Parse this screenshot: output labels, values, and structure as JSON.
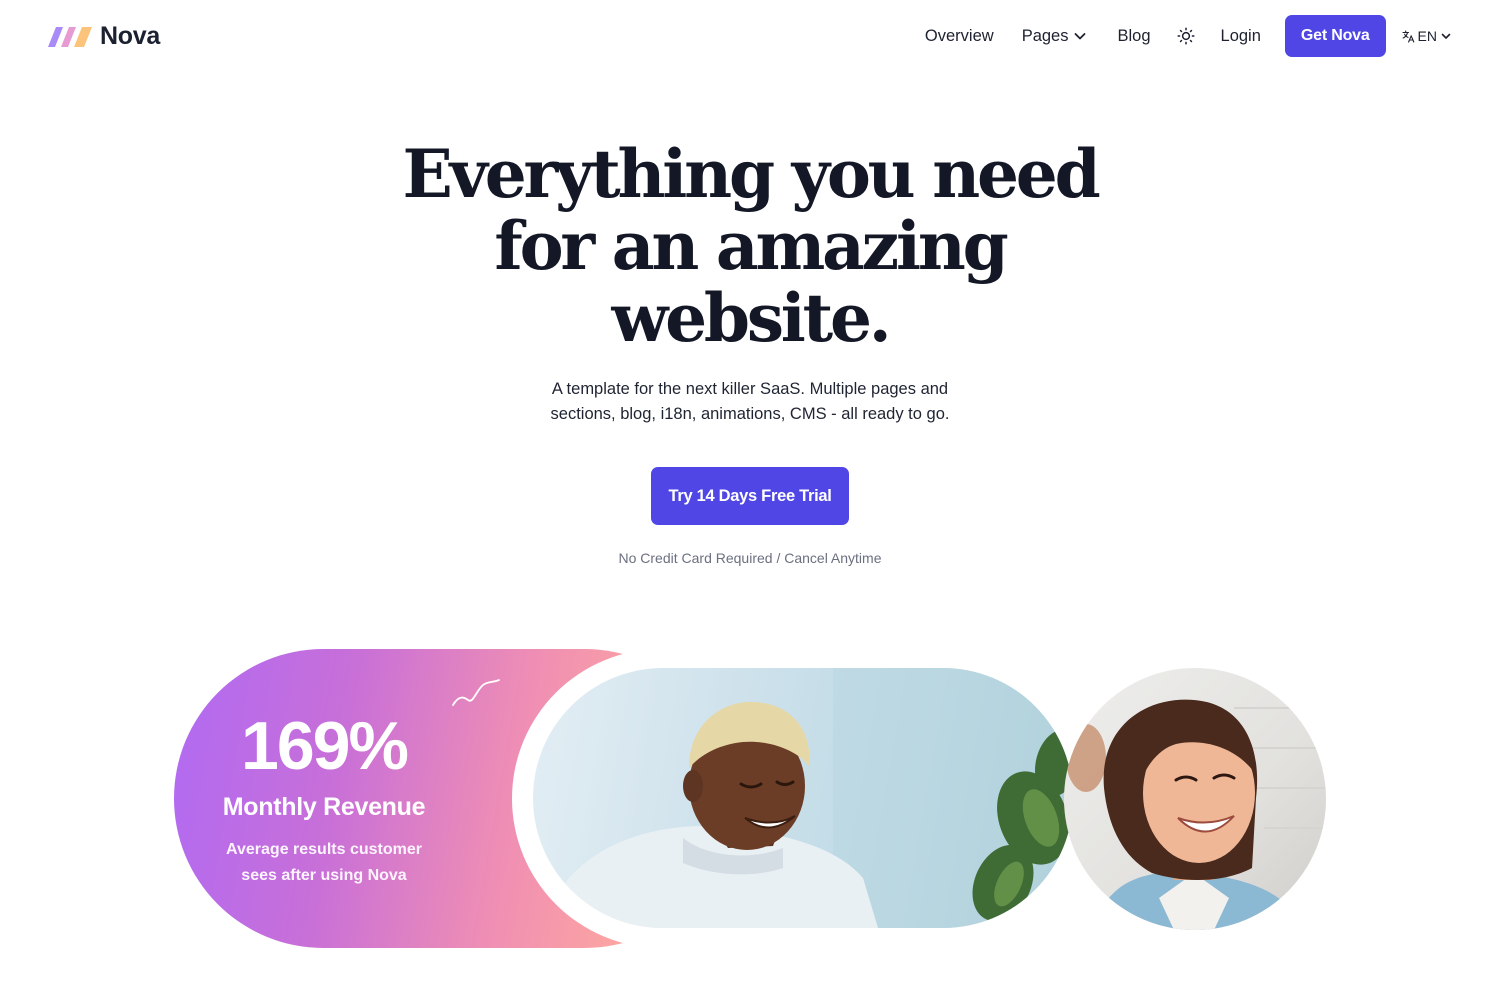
{
  "brand": {
    "name": "Nova",
    "logo_colors": [
      "#a98bf7",
      "#f59bc6",
      "#fcc47a"
    ]
  },
  "nav": {
    "items": [
      {
        "label": "Overview"
      },
      {
        "label": "Pages"
      },
      {
        "label": "Blog"
      }
    ],
    "theme_icon": "sun-icon",
    "login_label": "Login",
    "cta_label": "Get Nova",
    "language_label": "EN"
  },
  "hero": {
    "title_lines": [
      "Everything you need",
      "for an amazing",
      "website."
    ],
    "subtitle_lines": [
      "A template for the next killer SaaS. Multiple pages and",
      "sections, blog, i18n, animations, CMS - all ready to go."
    ],
    "cta_label": "Try 14 Days Free Trial",
    "note": "No Credit Card Required / Cancel Anytime"
  },
  "showcase": {
    "stat_value": "169%",
    "stat_label": "Monthly Revenue",
    "stat_description_lines": [
      "Average results customer",
      "sees after using Nova"
    ],
    "images": [
      "smiling-man-photo",
      "smiling-woman-photo"
    ]
  },
  "colors": {
    "accent": "#4f46e5",
    "text": "#141826",
    "muted": "#6b7080",
    "gradient": [
      "#b06af3",
      "#f08fb3",
      "#fcb39d"
    ]
  }
}
